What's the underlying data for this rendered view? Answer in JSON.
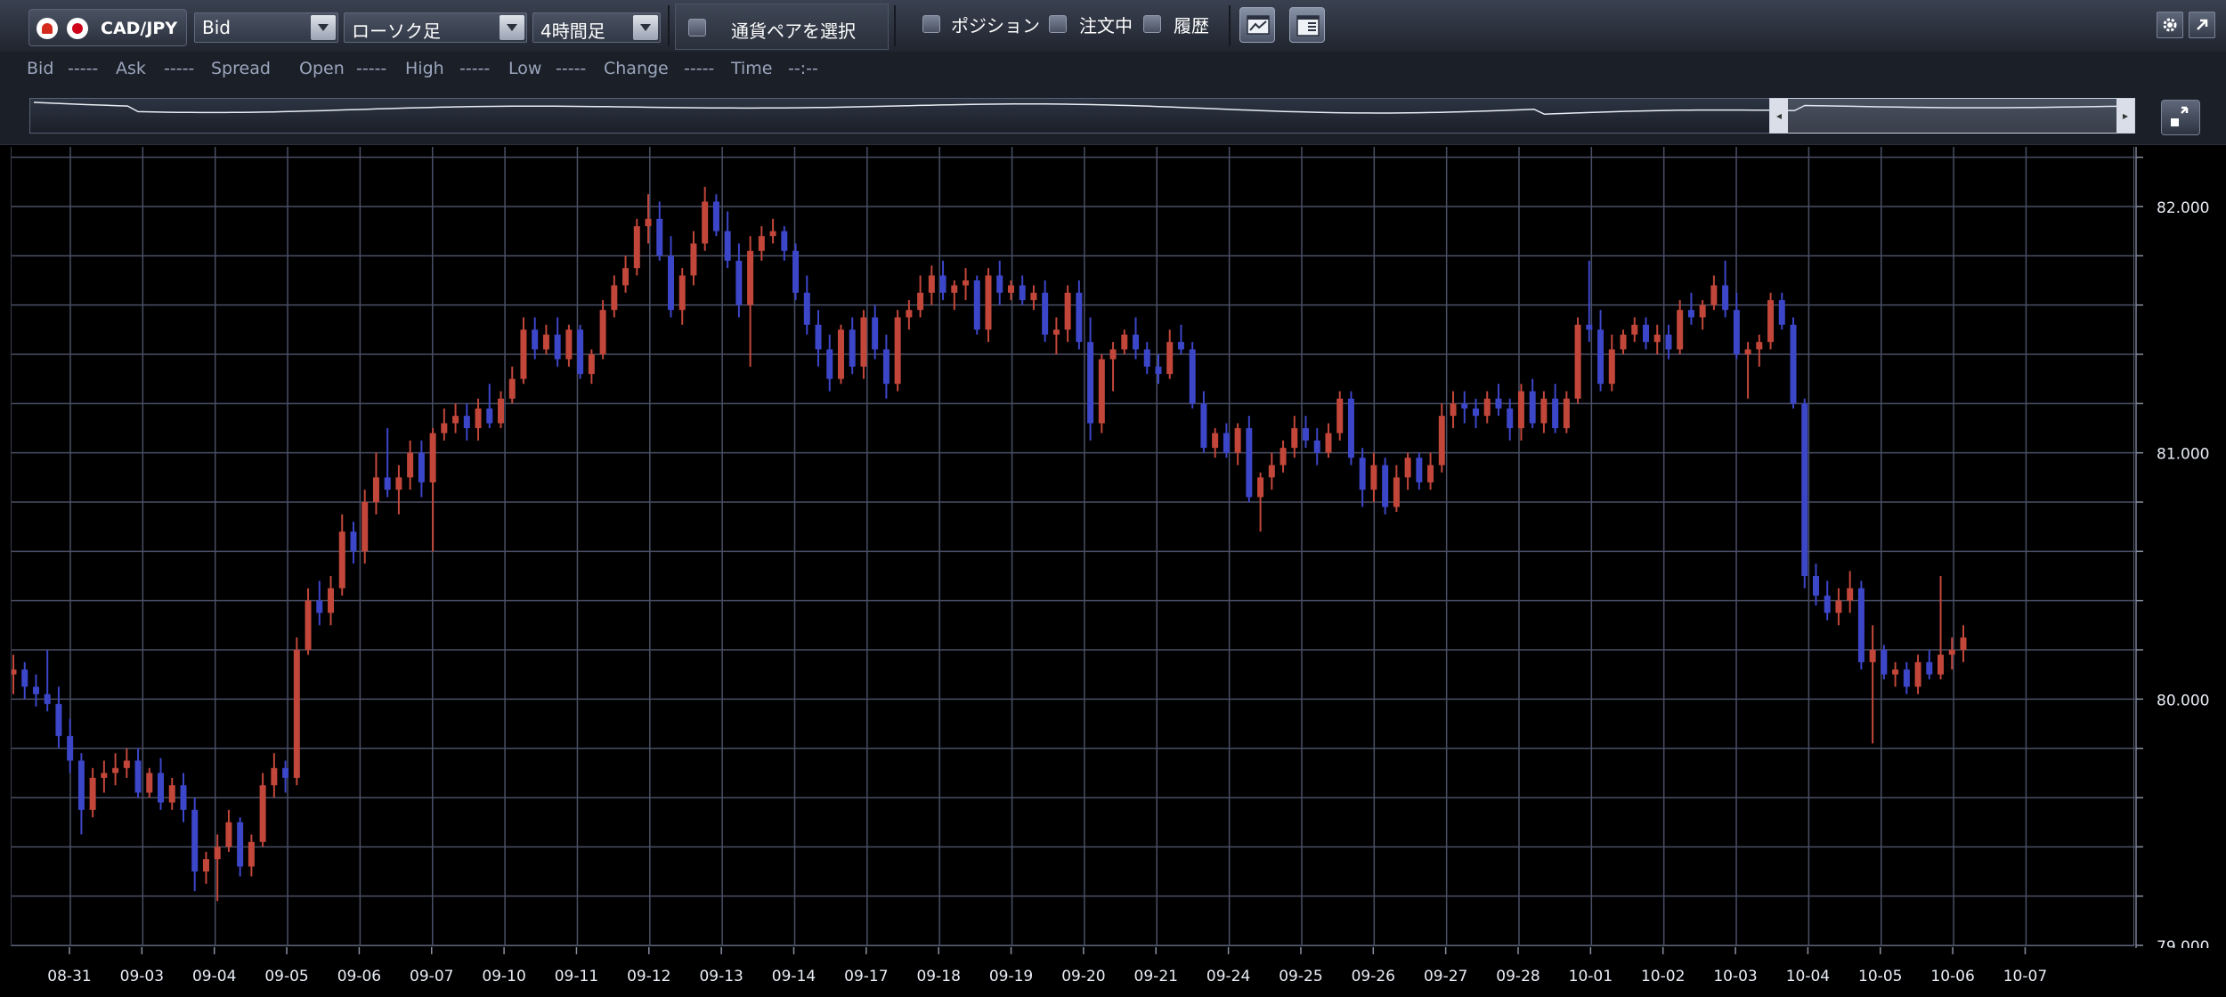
{
  "toolbar": {
    "pair": "CAD/JPY",
    "price_type": "Bid",
    "chart_type": "ローソク足",
    "timeframe": "4時間足",
    "pair_select_label": "通貨ペアを選択",
    "position_label": "ポジション",
    "order_label": "注文中",
    "history_label": "履歴"
  },
  "infobar": {
    "bid_label": "Bid",
    "bid_value": "-----",
    "ask_label": "Ask",
    "ask_value": "-----",
    "spread_label": "Spread",
    "open_label": "Open",
    "open_value": "-----",
    "high_label": "High",
    "high_value": "-----",
    "low_label": "Low",
    "low_value": "-----",
    "change_label": "Change",
    "change_value": "-----",
    "time_label": "Time",
    "time_value": "--:--"
  },
  "colors": {
    "up": "#c2473a",
    "down": "#3c46c8",
    "grid": "#4a4f66",
    "axis_text": "#e8ecf4"
  },
  "chart_data": {
    "type": "candlestick",
    "pair": "CAD/JPY",
    "timeframe": "4時間足",
    "ylim": [
      79.0,
      82.2
    ],
    "y_ticks": [
      "79.000",
      "80.000",
      "81.000",
      "82.000"
    ],
    "x_ticks": [
      "08-31",
      "09-03",
      "09-04",
      "09-05",
      "09-06",
      "09-07",
      "09-10",
      "09-11",
      "09-12",
      "09-13",
      "09-14",
      "09-17",
      "09-18",
      "09-19",
      "09-20",
      "09-21",
      "09-24",
      "09-25",
      "09-26",
      "09-27",
      "09-28",
      "10-01",
      "10-02",
      "10-03",
      "10-04",
      "10-05",
      "10-06",
      "10-07"
    ],
    "ohlc": [
      [
        80.1,
        80.18,
        80.02,
        80.12
      ],
      [
        80.12,
        80.15,
        80.0,
        80.05
      ],
      [
        80.05,
        80.1,
        79.97,
        80.02
      ],
      [
        80.02,
        80.2,
        79.95,
        79.98
      ],
      [
        79.98,
        80.05,
        79.8,
        79.85
      ],
      [
        79.85,
        79.92,
        79.7,
        79.75
      ],
      [
        79.75,
        79.78,
        79.45,
        79.55
      ],
      [
        79.55,
        79.72,
        79.52,
        79.68
      ],
      [
        79.68,
        79.75,
        79.62,
        79.7
      ],
      [
        79.7,
        79.78,
        79.65,
        79.72
      ],
      [
        79.72,
        79.8,
        79.68,
        79.75
      ],
      [
        79.75,
        79.8,
        79.6,
        79.62
      ],
      [
        79.62,
        79.72,
        79.6,
        79.7
      ],
      [
        79.7,
        79.76,
        79.55,
        79.58
      ],
      [
        79.58,
        79.68,
        79.55,
        79.65
      ],
      [
        79.65,
        79.7,
        79.5,
        79.55
      ],
      [
        79.55,
        79.6,
        79.22,
        79.3
      ],
      [
        79.3,
        79.38,
        79.25,
        79.35
      ],
      [
        79.35,
        79.45,
        79.18,
        79.4
      ],
      [
        79.4,
        79.55,
        79.38,
        79.5
      ],
      [
        79.5,
        79.52,
        79.28,
        79.32
      ],
      [
        79.32,
        79.45,
        79.28,
        79.42
      ],
      [
        79.42,
        79.7,
        79.4,
        79.65
      ],
      [
        79.65,
        79.78,
        79.6,
        79.72
      ],
      [
        79.72,
        79.75,
        79.62,
        79.68
      ],
      [
        79.68,
        80.25,
        79.65,
        80.2
      ],
      [
        80.2,
        80.45,
        80.18,
        80.4
      ],
      [
        80.4,
        80.48,
        80.3,
        80.35
      ],
      [
        80.35,
        80.5,
        80.3,
        80.45
      ],
      [
        80.45,
        80.75,
        80.42,
        80.68
      ],
      [
        80.68,
        80.72,
        80.55,
        80.6
      ],
      [
        80.6,
        80.85,
        80.55,
        80.8
      ],
      [
        80.8,
        81.0,
        80.75,
        80.9
      ],
      [
        80.9,
        81.1,
        80.82,
        80.85
      ],
      [
        80.85,
        80.95,
        80.75,
        80.9
      ],
      [
        80.9,
        81.05,
        80.85,
        81.0
      ],
      [
        81.0,
        81.05,
        80.82,
        80.88
      ],
      [
        80.88,
        81.1,
        80.6,
        81.08
      ],
      [
        81.08,
        81.18,
        81.05,
        81.12
      ],
      [
        81.12,
        81.2,
        81.08,
        81.15
      ],
      [
        81.15,
        81.2,
        81.05,
        81.1
      ],
      [
        81.1,
        81.22,
        81.05,
        81.18
      ],
      [
        81.18,
        81.28,
        81.1,
        81.12
      ],
      [
        81.12,
        81.25,
        81.1,
        81.22
      ],
      [
        81.22,
        81.35,
        81.2,
        81.3
      ],
      [
        81.3,
        81.55,
        81.28,
        81.5
      ],
      [
        81.5,
        81.55,
        81.38,
        81.42
      ],
      [
        81.42,
        81.52,
        81.4,
        81.48
      ],
      [
        81.48,
        81.55,
        81.35,
        81.38
      ],
      [
        81.38,
        81.52,
        81.35,
        81.5
      ],
      [
        81.5,
        81.52,
        81.3,
        81.32
      ],
      [
        81.32,
        81.42,
        81.28,
        81.4
      ],
      [
        81.4,
        81.62,
        81.38,
        81.58
      ],
      [
        81.58,
        81.72,
        81.55,
        81.68
      ],
      [
        81.68,
        81.8,
        81.65,
        81.75
      ],
      [
        81.75,
        81.95,
        81.72,
        81.92
      ],
      [
        81.92,
        82.05,
        81.85,
        81.95
      ],
      [
        81.95,
        82.02,
        81.78,
        81.8
      ],
      [
        81.8,
        81.88,
        81.55,
        81.58
      ],
      [
        81.58,
        81.75,
        81.52,
        81.72
      ],
      [
        81.72,
        81.9,
        81.68,
        81.85
      ],
      [
        81.85,
        82.08,
        81.82,
        82.02
      ],
      [
        82.02,
        82.05,
        81.88,
        81.9
      ],
      [
        81.9,
        81.98,
        81.75,
        81.78
      ],
      [
        81.78,
        81.85,
        81.55,
        81.6
      ],
      [
        81.6,
        81.88,
        81.35,
        81.82
      ],
      [
        81.82,
        81.92,
        81.78,
        81.88
      ],
      [
        81.88,
        81.95,
        81.85,
        81.9
      ],
      [
        81.9,
        81.92,
        81.78,
        81.82
      ],
      [
        81.82,
        81.85,
        81.62,
        81.65
      ],
      [
        81.65,
        81.72,
        81.48,
        81.52
      ],
      [
        81.52,
        81.58,
        81.35,
        81.42
      ],
      [
        81.42,
        81.48,
        81.25,
        81.3
      ],
      [
        81.3,
        81.52,
        81.28,
        81.5
      ],
      [
        81.5,
        81.55,
        81.32,
        81.35
      ],
      [
        81.35,
        81.58,
        81.3,
        81.55
      ],
      [
        81.55,
        81.6,
        81.38,
        81.42
      ],
      [
        81.42,
        81.48,
        81.22,
        81.28
      ],
      [
        81.28,
        81.58,
        81.25,
        81.55
      ],
      [
        81.55,
        81.62,
        81.5,
        81.58
      ],
      [
        81.58,
        81.72,
        81.55,
        81.65
      ],
      [
        81.65,
        81.76,
        81.6,
        81.72
      ],
      [
        81.72,
        81.78,
        81.62,
        81.65
      ],
      [
        81.65,
        81.7,
        81.58,
        81.68
      ],
      [
        81.68,
        81.75,
        81.62,
        81.7
      ],
      [
        81.7,
        81.72,
        81.48,
        81.5
      ],
      [
        81.5,
        81.75,
        81.45,
        81.72
      ],
      [
        81.72,
        81.78,
        81.6,
        81.65
      ],
      [
        81.65,
        81.7,
        81.62,
        81.68
      ],
      [
        81.68,
        81.72,
        81.6,
        81.62
      ],
      [
        81.62,
        81.68,
        81.58,
        81.65
      ],
      [
        81.65,
        81.7,
        81.45,
        81.48
      ],
      [
        81.48,
        81.55,
        81.4,
        81.5
      ],
      [
        81.5,
        81.68,
        81.45,
        81.65
      ],
      [
        81.65,
        81.7,
        81.42,
        81.45
      ],
      [
        81.45,
        81.55,
        81.05,
        81.12
      ],
      [
        81.12,
        81.4,
        81.08,
        81.38
      ],
      [
        81.38,
        81.45,
        81.25,
        81.42
      ],
      [
        81.42,
        81.5,
        81.4,
        81.48
      ],
      [
        81.48,
        81.55,
        81.38,
        81.42
      ],
      [
        81.42,
        81.45,
        81.32,
        81.35
      ],
      [
        81.35,
        81.4,
        81.28,
        81.32
      ],
      [
        81.32,
        81.5,
        81.3,
        81.45
      ],
      [
        81.45,
        81.52,
        81.4,
        81.42
      ],
      [
        81.42,
        81.45,
        81.18,
        81.2
      ],
      [
        81.2,
        81.25,
        81.0,
        81.02
      ],
      [
        81.02,
        81.1,
        80.98,
        81.08
      ],
      [
        81.08,
        81.12,
        80.98,
        81.0
      ],
      [
        81.0,
        81.12,
        80.95,
        81.1
      ],
      [
        81.1,
        81.15,
        80.8,
        80.82
      ],
      [
        80.82,
        80.92,
        80.68,
        80.9
      ],
      [
        80.9,
        81.0,
        80.85,
        80.95
      ],
      [
        80.95,
        81.05,
        80.92,
        81.02
      ],
      [
        81.02,
        81.15,
        80.98,
        81.1
      ],
      [
        81.1,
        81.15,
        81.02,
        81.05
      ],
      [
        81.05,
        81.1,
        80.95,
        81.0
      ],
      [
        81.0,
        81.12,
        80.98,
        81.08
      ],
      [
        81.08,
        81.25,
        81.05,
        81.22
      ],
      [
        81.22,
        81.25,
        80.95,
        80.98
      ],
      [
        80.98,
        81.02,
        80.78,
        80.85
      ],
      [
        80.85,
        81.0,
        80.8,
        80.95
      ],
      [
        80.95,
        80.98,
        80.75,
        80.78
      ],
      [
        80.78,
        80.95,
        80.76,
        80.9
      ],
      [
        80.9,
        81.0,
        80.85,
        80.98
      ],
      [
        80.98,
        81.0,
        80.85,
        80.88
      ],
      [
        80.88,
        81.0,
        80.85,
        80.95
      ],
      [
        80.95,
        81.2,
        80.92,
        81.15
      ],
      [
        81.15,
        81.25,
        81.1,
        81.2
      ],
      [
        81.2,
        81.25,
        81.12,
        81.18
      ],
      [
        81.18,
        81.22,
        81.1,
        81.15
      ],
      [
        81.15,
        81.25,
        81.12,
        81.22
      ],
      [
        81.22,
        81.28,
        81.15,
        81.18
      ],
      [
        81.18,
        81.22,
        81.05,
        81.1
      ],
      [
        81.1,
        81.28,
        81.05,
        81.25
      ],
      [
        81.25,
        81.3,
        81.1,
        81.12
      ],
      [
        81.12,
        81.25,
        81.08,
        81.22
      ],
      [
        81.22,
        81.28,
        81.08,
        81.1
      ],
      [
        81.1,
        81.25,
        81.08,
        81.22
      ],
      [
        81.22,
        81.55,
        81.2,
        81.52
      ],
      [
        81.52,
        81.78,
        81.45,
        81.5
      ],
      [
        81.5,
        81.58,
        81.25,
        81.28
      ],
      [
        81.28,
        81.48,
        81.25,
        81.42
      ],
      [
        81.42,
        81.5,
        81.4,
        81.48
      ],
      [
        81.48,
        81.55,
        81.45,
        81.52
      ],
      [
        81.52,
        81.55,
        81.42,
        81.45
      ],
      [
        81.45,
        81.52,
        81.4,
        81.48
      ],
      [
        81.48,
        81.52,
        81.38,
        81.42
      ],
      [
        81.42,
        81.62,
        81.4,
        81.58
      ],
      [
        81.58,
        81.65,
        81.52,
        81.55
      ],
      [
        81.55,
        81.62,
        81.5,
        81.6
      ],
      [
        81.6,
        81.72,
        81.58,
        81.68
      ],
      [
        81.68,
        81.78,
        81.55,
        81.58
      ],
      [
        81.58,
        81.65,
        81.38,
        81.4
      ],
      [
        81.4,
        81.45,
        81.22,
        81.42
      ],
      [
        81.42,
        81.48,
        81.35,
        81.45
      ],
      [
        81.45,
        81.65,
        81.42,
        81.62
      ],
      [
        81.62,
        81.65,
        81.5,
        81.52
      ],
      [
        81.52,
        81.55,
        81.18,
        81.2
      ],
      [
        81.2,
        81.22,
        80.45,
        80.5
      ],
      [
        80.5,
        80.55,
        80.38,
        80.42
      ],
      [
        80.42,
        80.48,
        80.32,
        80.35
      ],
      [
        80.35,
        80.45,
        80.3,
        80.4
      ],
      [
        80.4,
        80.52,
        80.35,
        80.45
      ],
      [
        80.45,
        80.48,
        80.12,
        80.15
      ],
      [
        80.15,
        80.3,
        79.82,
        80.2
      ],
      [
        80.2,
        80.22,
        80.08,
        80.1
      ],
      [
        80.1,
        80.15,
        80.05,
        80.12
      ],
      [
        80.12,
        80.15,
        80.02,
        80.05
      ],
      [
        80.05,
        80.18,
        80.02,
        80.15
      ],
      [
        80.15,
        80.2,
        80.08,
        80.1
      ],
      [
        80.1,
        80.5,
        80.08,
        80.18
      ],
      [
        80.18,
        80.25,
        80.12,
        80.2
      ],
      [
        80.2,
        80.3,
        80.15,
        80.25
      ]
    ]
  }
}
